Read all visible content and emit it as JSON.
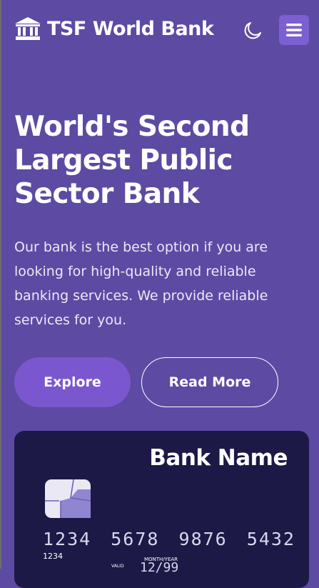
{
  "header": {
    "brand_icon": "bank-icon",
    "brand_name": "TSF World Bank",
    "theme_icon": "moon-icon",
    "menu_icon": "hamburger-menu-icon"
  },
  "hero": {
    "title": "World's Second Largest Public Sector Bank",
    "description": "Our bank is the best option if you are looking for high-quality and reliable banking services. We provide reliable services for you."
  },
  "buttons": {
    "explore_label": "Explore",
    "read_more_label": "Read More"
  },
  "card": {
    "bank_name": "Bank Name",
    "chip_icon": "card-chip-icon",
    "number": "1234 5678 9876 5432",
    "number_small": "1234",
    "expiry_label": "MONTH/YEAR",
    "valid_label": "VALID",
    "expiry": "12/99"
  },
  "colors": {
    "background": "#5d4aa3",
    "accent": "#7b57cf",
    "menu_button": "#7c5fd0",
    "card": "#1c1947",
    "text": "#ffffff"
  }
}
